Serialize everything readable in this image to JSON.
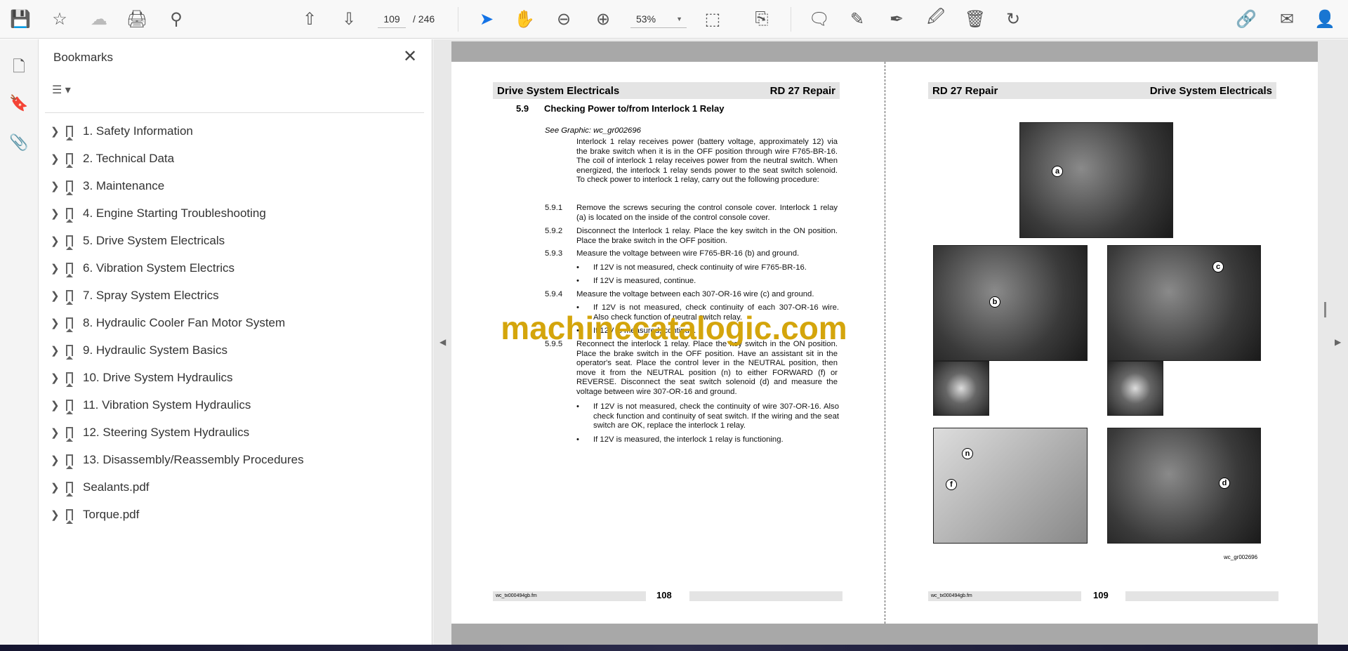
{
  "toolbar": {
    "page_current": "109",
    "page_total": "/ 246",
    "zoom": "53%"
  },
  "bookmarks": {
    "title": "Bookmarks",
    "items": [
      "1. Safety Information",
      "2. Technical Data",
      "3. Maintenance",
      "4. Engine Starting Troubleshooting",
      "5. Drive System Electricals",
      "6. Vibration System Electrics",
      "7. Spray System Electrics",
      "8. Hydraulic Cooler Fan Motor System",
      "9. Hydraulic System Basics",
      "10. Drive System Hydraulics",
      "11. Vibration System Hydraulics",
      "12. Steering System Hydraulics",
      "13. Disassembly/Reassembly Procedures",
      "Sealants.pdf",
      "Torque.pdf"
    ]
  },
  "left_page": {
    "header_left": "Drive System Electricals",
    "header_right": "RD 27 Repair",
    "section_num": "5.9",
    "section_title": "Checking Power to/from Interlock 1 Relay",
    "see_graphic": "See Graphic: wc_gr002696",
    "intro": "Interlock 1 relay receives power (battery voltage, approximately 12) via the brake switch when it is in the OFF position through wire F765-BR-16. The coil of interlock 1 relay receives power from the neutral switch. When energized, the interlock 1 relay sends power to the seat switch solenoid. To check power to interlock 1 relay, carry out the following procedure:",
    "steps": [
      {
        "num": "5.9.1",
        "text": "Remove the screws securing the control console cover. Interlock 1 relay (a) is located on the inside of the control console cover."
      },
      {
        "num": "5.9.2",
        "text": "Disconnect the Interlock 1 relay. Place the key switch in the ON position. Place the brake switch in the OFF position."
      },
      {
        "num": "5.9.3",
        "text": "Measure the voltage between wire F765-BR-16 (b) and ground."
      },
      {
        "num": "5.9.4",
        "text": "Measure the voltage between each 307-OR-16 wire (c) and ground."
      },
      {
        "num": "5.9.5",
        "text": "Reconnect the interlock 1 relay. Place the key switch in the ON position. Place the brake switch in the OFF position. Have an assistant sit in the operator's seat. Place the control lever in the NEUTRAL position, then move it from the NEUTRAL position (n) to either FORWARD (f) or REVERSE. Disconnect the seat switch solenoid (d) and measure the voltage between wire 307-OR-16 and ground."
      }
    ],
    "bullets": {
      "s3": [
        "If 12V is not measured, check continuity of wire F765-BR-16.",
        "If 12V is measured, continue."
      ],
      "s4": [
        "If 12V is not measured, check continuity of each 307-OR-16 wire. Also check function of neutral switch relay.",
        "If 12V is measured, continue."
      ],
      "s5": [
        "If 12V is not measured, check the continuity of wire 307-OR-16. Also check function and continuity of seat switch. If the wiring and the seat switch are OK, replace the interlock 1 relay.",
        "If 12V is measured, the interlock 1 relay is functioning."
      ]
    },
    "footer_file": "wc_tx000494gb.fm",
    "page_number": "108"
  },
  "right_page": {
    "header_left": "RD 27 Repair",
    "header_right": "Drive System Electricals",
    "callouts": [
      "a",
      "b",
      "c",
      "n",
      "f",
      "d"
    ],
    "graphic_id": "wc_gr002696",
    "footer_file": "wc_tx000494gb.fm",
    "page_number": "109"
  },
  "watermark": "machinecatalogic.com"
}
